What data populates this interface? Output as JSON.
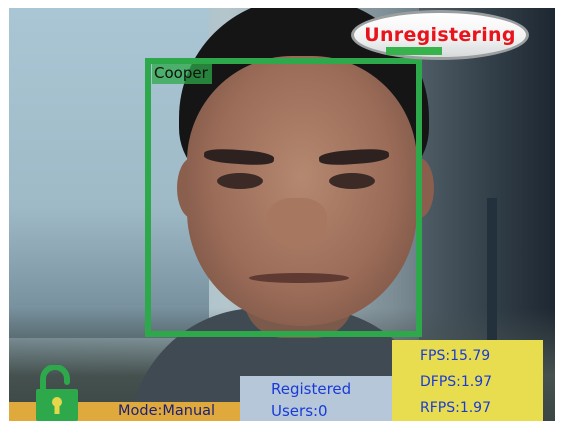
{
  "detection": {
    "name": "Cooper"
  },
  "status": {
    "label": "Unregistering"
  },
  "stats": {
    "fps": "FPS:15.79",
    "dfps": "DFPS:1.97",
    "rfps": "RFPS:1.97"
  },
  "registered": {
    "line1": "Registered",
    "line2": "Users:0"
  },
  "mode": {
    "label": "Mode:Manual"
  },
  "icons": {
    "lock": "unlocked-padlock-icon"
  },
  "colors": {
    "face_box": "#2da84a",
    "status_text": "#e8131b",
    "stats_bg": "#e8dd4f",
    "stats_text": "#1a3ad8",
    "registered_bg": "#b5c7d9",
    "mode_bg": "#e0a93b",
    "mode_text": "#1a1f7a",
    "lock_green": "#2da84a"
  }
}
